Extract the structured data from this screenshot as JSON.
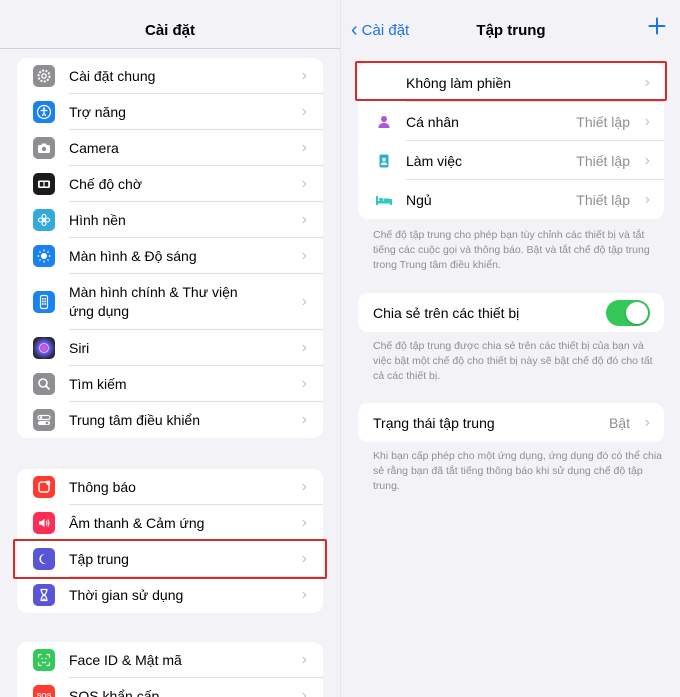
{
  "left": {
    "title": "Cài đặt",
    "groups": [
      {
        "items": [
          {
            "label": "Cài đặt chung",
            "icon": "gear-icon",
            "color": "#8e8e93"
          },
          {
            "label": "Trợ năng",
            "icon": "accessibility-icon",
            "color": "#1a82f0"
          },
          {
            "label": "Camera",
            "icon": "camera-icon",
            "color": "#8e8e93"
          },
          {
            "label": "Chế độ chờ",
            "icon": "standby-icon",
            "color": "#1c1c1e"
          },
          {
            "label": "Hình nền",
            "icon": "wallpaper-icon",
            "color": "#34aadc"
          },
          {
            "label": "Màn hình & Độ sáng",
            "icon": "brightness-icon",
            "color": "#1a82f0"
          },
          {
            "label": "Màn hình chính & Thư viện ứng dụng",
            "icon": "home-screen-icon",
            "color": "#1a82f0"
          },
          {
            "label": "Siri",
            "icon": "siri-icon",
            "color": "#2b2b3a"
          },
          {
            "label": "Tìm kiếm",
            "icon": "search-icon",
            "color": "#8e8e93"
          },
          {
            "label": "Trung tâm điều khiển",
            "icon": "control-center-icon",
            "color": "#8e8e93"
          }
        ]
      },
      {
        "items": [
          {
            "label": "Thông báo",
            "icon": "notification-icon",
            "color": "#ff3b30"
          },
          {
            "label": "Âm thanh & Cảm ứng",
            "icon": "sound-icon",
            "color": "#ff2d55"
          },
          {
            "label": "Tập trung",
            "icon": "moon-icon",
            "color": "#5856d6"
          },
          {
            "label": "Thời gian sử dụng",
            "icon": "hourglass-icon",
            "color": "#5856d6"
          }
        ]
      },
      {
        "items": [
          {
            "label": "Face ID & Mật mã",
            "icon": "face-id-icon",
            "color": "#34c759"
          },
          {
            "label": "SOS khẩn cấp",
            "icon": "sos-icon",
            "color": "#ff3b30"
          }
        ]
      }
    ]
  },
  "right": {
    "back_label": "Cài đặt",
    "title": "Tập trung",
    "modes": [
      {
        "label": "Không làm phiền",
        "value": "",
        "icon": "moon-icon",
        "color": "#5856d6"
      },
      {
        "label": "Cá nhân",
        "value": "Thiết lập",
        "icon": "person-icon",
        "color": "#af52de"
      },
      {
        "label": "Làm việc",
        "value": "Thiết lập",
        "icon": "work-badge-icon",
        "color": "#30b0c7"
      },
      {
        "label": "Ngủ",
        "value": "Thiết lập",
        "icon": "bed-icon",
        "color": "#30c7be"
      }
    ],
    "modes_footer": "Chế độ tập trung cho phép bạn tùy chỉnh các thiết bị và tắt tiếng các cuộc gọi và thông báo. Bật và tắt chế độ tập trung trong Trung tâm điều khiển.",
    "share": {
      "label": "Chia sẻ trên các thiết bị",
      "enabled": true
    },
    "share_footer": "Chế độ tập trung được chia sẻ trên các thiết bị của bạn và việc bật một chế độ cho thiết bị này sẽ bật chế độ đó cho tất cả các thiết bị.",
    "status": {
      "label": "Trạng thái tập trung",
      "value": "Bật"
    },
    "status_footer": "Khi bạn cấp phép cho một ứng dụng, ứng dụng đó có thể chia sẻ rằng bạn đã tắt tiếng thông báo khi sử dụng chế độ tập trung."
  },
  "colors": {
    "accent": "#1a73e8",
    "toggle_on": "#34c759",
    "highlight": "#d42b2b"
  }
}
